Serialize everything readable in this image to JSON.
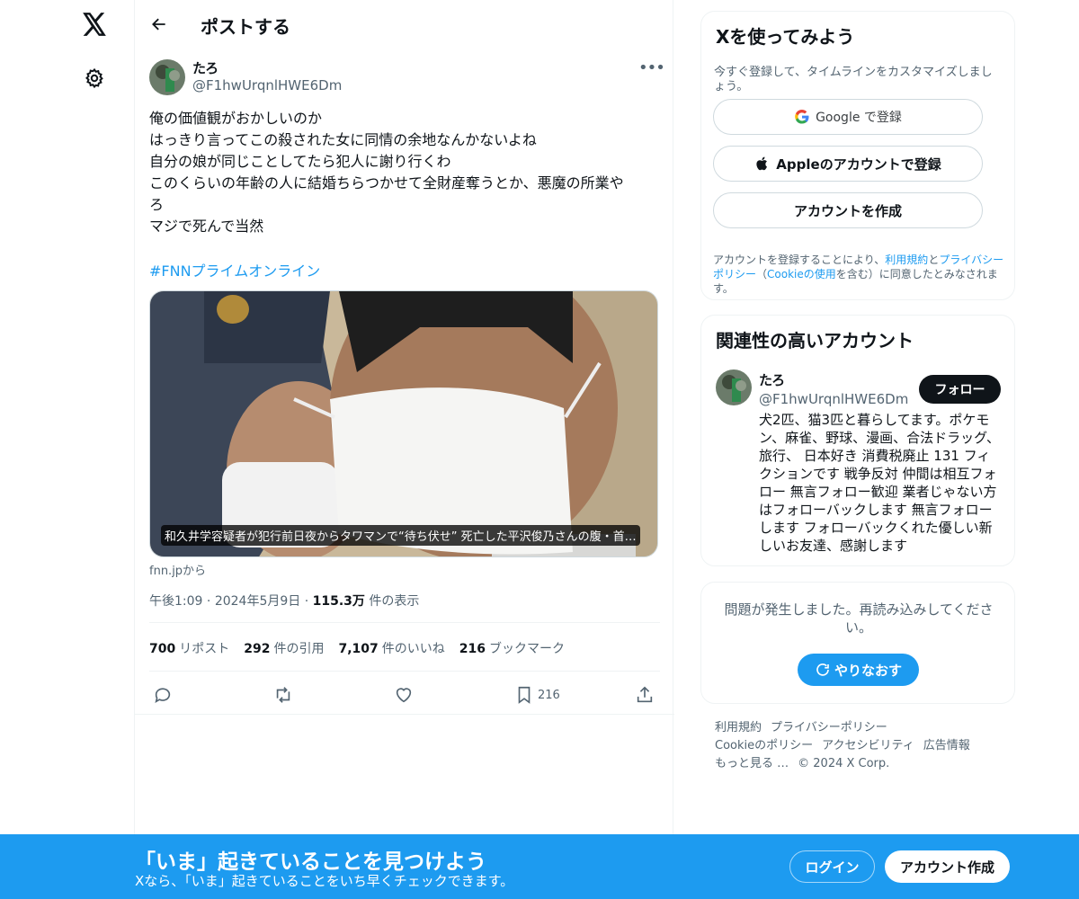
{
  "nav": {
    "logo": "x-logo",
    "settings_icon": "gear-icon"
  },
  "topbar": {
    "back_icon": "arrow-left-icon",
    "title": "ポストする"
  },
  "post": {
    "author_name": "たろ",
    "author_handle": "@F1hwUrqnlHWE6Dm",
    "more_icon": "ellipsis-icon",
    "text_lines": [
      "俺の価値観がおかしいのか",
      "はっきり言ってこの殺された女に同情の余地なんかないよね",
      "自分の娘が同じことしてたら犯人に謝り行くわ",
      "このくらいの年齢の人に結婚ちらつかせて全財産奪うとか、悪魔の所業や",
      "ろ",
      "マジで死んで当然"
    ],
    "hashtag": "#FNNプライムオンライン",
    "card": {
      "caption": "和久井学容疑者が犯行前日夜からタワマンで“待ち伏せ” 死亡した平沢俊乃さんの腹・首…",
      "source": "fnn.jpから"
    },
    "time": "午後1:09",
    "date": "2024年5月9日",
    "views_count": "115.3万",
    "views_label": "件の表示",
    "stats": {
      "reposts_count": "700",
      "reposts_label": "リポスト",
      "quotes_count": "292",
      "quotes_label": "件の引用",
      "likes_count": "7,107",
      "likes_label": "件のいいね",
      "bookmarks_count": "216",
      "bookmarks_label": "ブックマーク"
    },
    "actions": {
      "reply_icon": "reply-icon",
      "repost_icon": "repost-icon",
      "like_icon": "heart-icon",
      "bookmark_icon": "bookmark-icon",
      "bookmark_count": "216",
      "share_icon": "share-icon"
    }
  },
  "signup": {
    "title": "Xを使ってみよう",
    "subtitle": "今すぐ登録して、タイムラインをカスタマイズしましょう。",
    "google_label": "Google で登録",
    "apple_label": "Appleのアカウントで登録",
    "create_label": "アカウントを作成",
    "legal_1": "アカウントを登録することにより、",
    "legal_terms": "利用規約",
    "legal_2": "と",
    "legal_privacy": "プライバシーポリシー",
    "legal_3": "（",
    "legal_cookie": "Cookieの使用",
    "legal_4": "を含む）に同意したとみなされます。"
  },
  "related": {
    "title": "関連性の高いアカウント",
    "name": "たろ",
    "handle": "@F1hwUrqnlHWE6Dm",
    "follow_label": "フォロー",
    "bio": "犬2匹、猫3匹と暮らしてます。ポケモン、麻雀、野球、漫画、合法ドラッグ、旅行、 日本好き 消費税廃止 131 フィクションです 戦争反対 仲間は相互フォロー 無言フォロー歓迎 業者じゃない方はフォローバックします 無言フォローします フォローバックくれた優しい新しいお友達、感謝します"
  },
  "error_panel": {
    "message": "問題が発生しました。再読み込みしてください。",
    "retry_label": "やりなおす"
  },
  "footer": {
    "terms": "利用規約",
    "privacy": "プライバシーポリシー",
    "cookie": "Cookieのポリシー",
    "accessibility": "アクセシビリティ",
    "ads": "広告情報",
    "more": "もっと見る …",
    "copyright": "© 2024 X Corp."
  },
  "bottom_bar": {
    "title": "「いま」起きていることを見つけよう",
    "subtitle": "Xなら、「いま」起きていることをいち早くチェックできます。",
    "login_label": "ログイン",
    "create_label": "アカウント作成"
  },
  "colors": {
    "accent": "#1d9bf0",
    "text": "#0f1419",
    "muted": "#536471",
    "border": "#eff3f4"
  }
}
